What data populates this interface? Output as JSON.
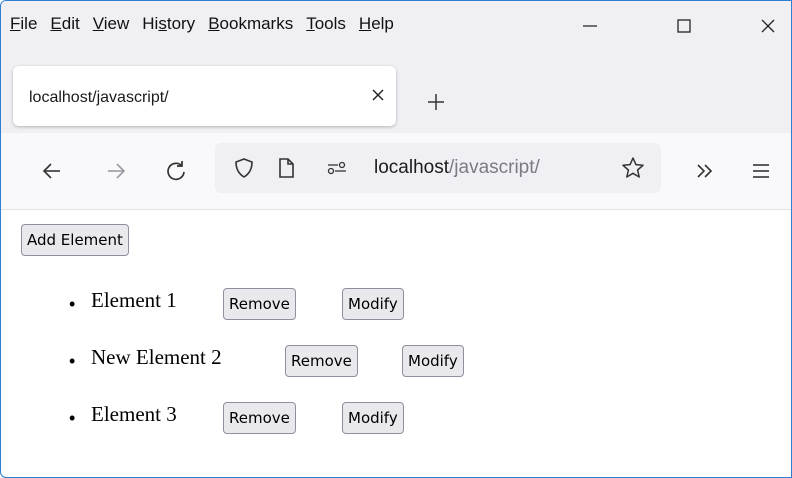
{
  "menu": {
    "items": [
      {
        "accel": "F",
        "rest": "ile"
      },
      {
        "accel": "E",
        "rest": "dit"
      },
      {
        "accel": "V",
        "rest": "iew"
      },
      {
        "pre": "Hi",
        "accel": "s",
        "rest": "tory"
      },
      {
        "accel": "B",
        "rest": "ookmarks"
      },
      {
        "accel": "T",
        "rest": "ools"
      },
      {
        "accel": "H",
        "rest": "elp"
      }
    ]
  },
  "window_controls": {
    "minimize": "minimize-icon",
    "maximize": "maximize-icon",
    "close": "close-icon"
  },
  "tab": {
    "title": "localhost/javascript/"
  },
  "navigation": {
    "url_host": "localhost",
    "url_path": "/javascript/"
  },
  "page": {
    "add_button": "Add Element",
    "items": [
      {
        "text": "Element 1",
        "remove": "Remove",
        "modify": "Modify"
      },
      {
        "text": "New Element 2",
        "remove": "Remove",
        "modify": "Modify"
      },
      {
        "text": "Element 3",
        "remove": "Remove",
        "modify": "Modify"
      }
    ]
  }
}
